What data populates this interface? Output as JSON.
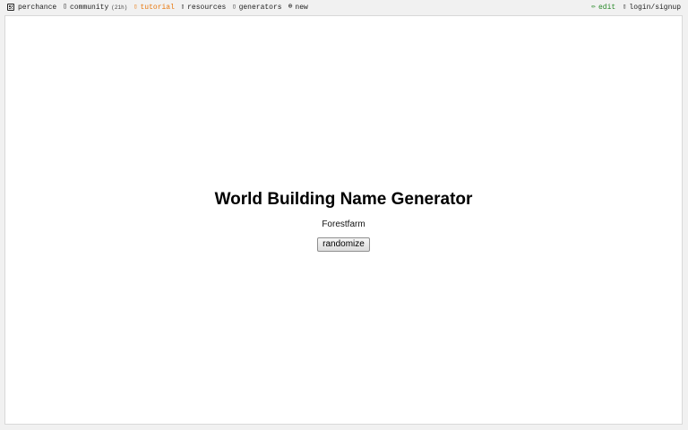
{
  "nav": {
    "brand": "perchance",
    "community": "community",
    "community_badge": "(21h)",
    "tutorial": "tutorial",
    "resources": "resources",
    "generators": "generators",
    "new": "new",
    "edit": "edit",
    "login": "login/signup"
  },
  "icons": {
    "brand": "dice-icon",
    "community": "chat-icon",
    "tutorial": "book-icon",
    "resources": "folder-icon",
    "generators": "list-icon",
    "new": "plus-circle-icon",
    "edit": "pencil-icon",
    "login": "user-icon"
  },
  "colors": {
    "tutorial": "#e8780e",
    "edit": "#2a8a2a"
  },
  "main": {
    "title": "World Building Name Generator",
    "output": "Forestfarm",
    "button_label": "randomize"
  }
}
